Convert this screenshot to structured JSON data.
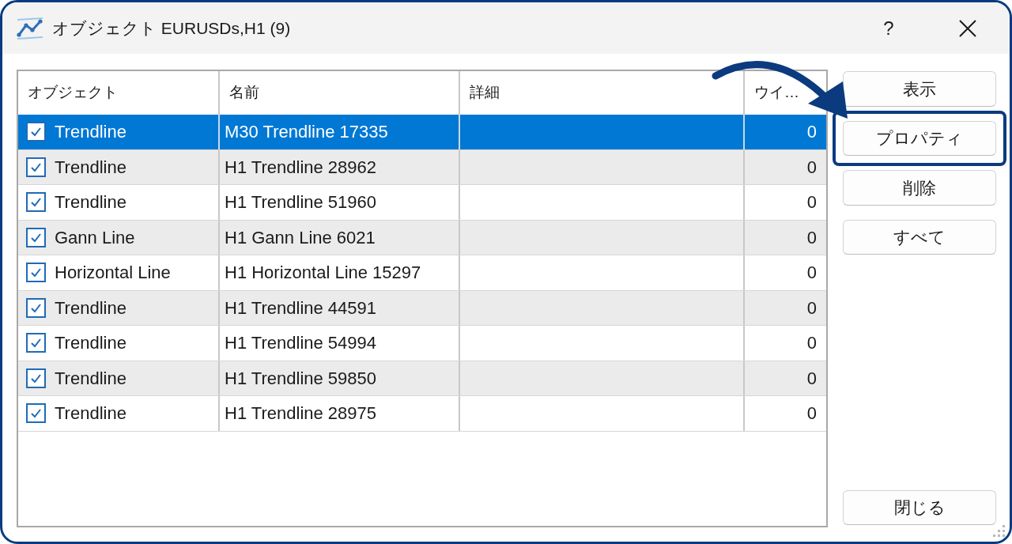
{
  "window": {
    "title": "オブジェクト EURUSDs,H1 (9)",
    "help": "?"
  },
  "table": {
    "columns": [
      "オブジェクト",
      "名前",
      "詳細",
      "ウイ…"
    ],
    "rows": [
      {
        "object": "Trendline",
        "name": "M30 Trendline 17335",
        "column_4": "0",
        "checked": true,
        "selected": true
      },
      {
        "object": "Trendline",
        "name": "H1 Trendline 28962",
        "column_4": "0",
        "checked": true,
        "selected": false
      },
      {
        "object": "Trendline",
        "name": "H1 Trendline 51960",
        "column_4": "0",
        "checked": true,
        "selected": false
      },
      {
        "object": "Gann Line",
        "name": "H1 Gann Line 6021",
        "column_4": "0",
        "checked": true,
        "selected": false
      },
      {
        "object": "Horizontal Line",
        "name": "H1 Horizontal Line 15297",
        "column_4": "0",
        "checked": true,
        "selected": false
      },
      {
        "object": "Trendline",
        "name": "H1 Trendline 44591",
        "column_4": "0",
        "checked": true,
        "selected": false
      },
      {
        "object": "Trendline",
        "name": "H1 Trendline 54994",
        "column_4": "0",
        "checked": true,
        "selected": false
      },
      {
        "object": "Trendline",
        "name": "H1 Trendline 59850",
        "column_4": "0",
        "checked": true,
        "selected": false
      },
      {
        "object": "Trendline",
        "name": "H1 Trendline 28975",
        "column_4": "0",
        "checked": true,
        "selected": false
      }
    ]
  },
  "buttons": [
    {
      "label": "表示",
      "highlighted": false
    },
    {
      "label": "プロパティ",
      "highlighted": true
    },
    {
      "label": "削除",
      "highlighted": false
    },
    {
      "label": "すべて",
      "highlighted": false
    }
  ],
  "close_button": {
    "label": "閉じる"
  }
}
